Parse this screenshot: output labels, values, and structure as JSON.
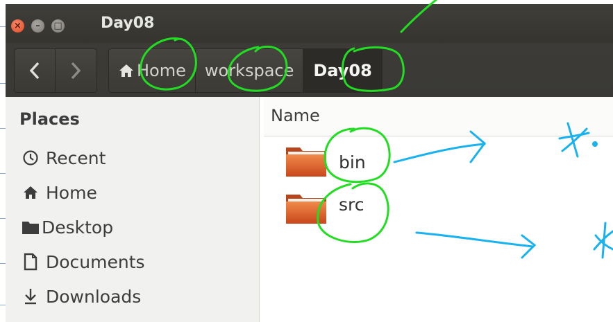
{
  "window": {
    "title": "Day08",
    "controls": [
      "close",
      "minimize",
      "maximize"
    ]
  },
  "toolbar": {
    "back_icon": "chevron-left-icon",
    "forward_icon": "chevron-right-icon",
    "breadcrumbs": [
      "Home",
      "workspace",
      "Day08"
    ]
  },
  "sidebar": {
    "section_title": "Places",
    "items": [
      {
        "label": "Recent",
        "icon": "clock-icon"
      },
      {
        "label": "Home",
        "icon": "home-icon"
      },
      {
        "label": "Desktop",
        "icon": "folder-icon"
      },
      {
        "label": "Documents",
        "icon": "document-icon"
      },
      {
        "label": "Downloads",
        "icon": "download-icon"
      }
    ]
  },
  "main": {
    "column_header": "Name",
    "files": [
      {
        "name": "bin",
        "icon": "folder-icon"
      },
      {
        "name": "src",
        "icon": "folder-icon"
      }
    ]
  },
  "colors": {
    "titlebar": "#3c3b37",
    "close_button": "#e95420",
    "folder": "#e2601f",
    "annotation_green": "#22dd22",
    "annotation_blue": "#1ab2ee"
  }
}
